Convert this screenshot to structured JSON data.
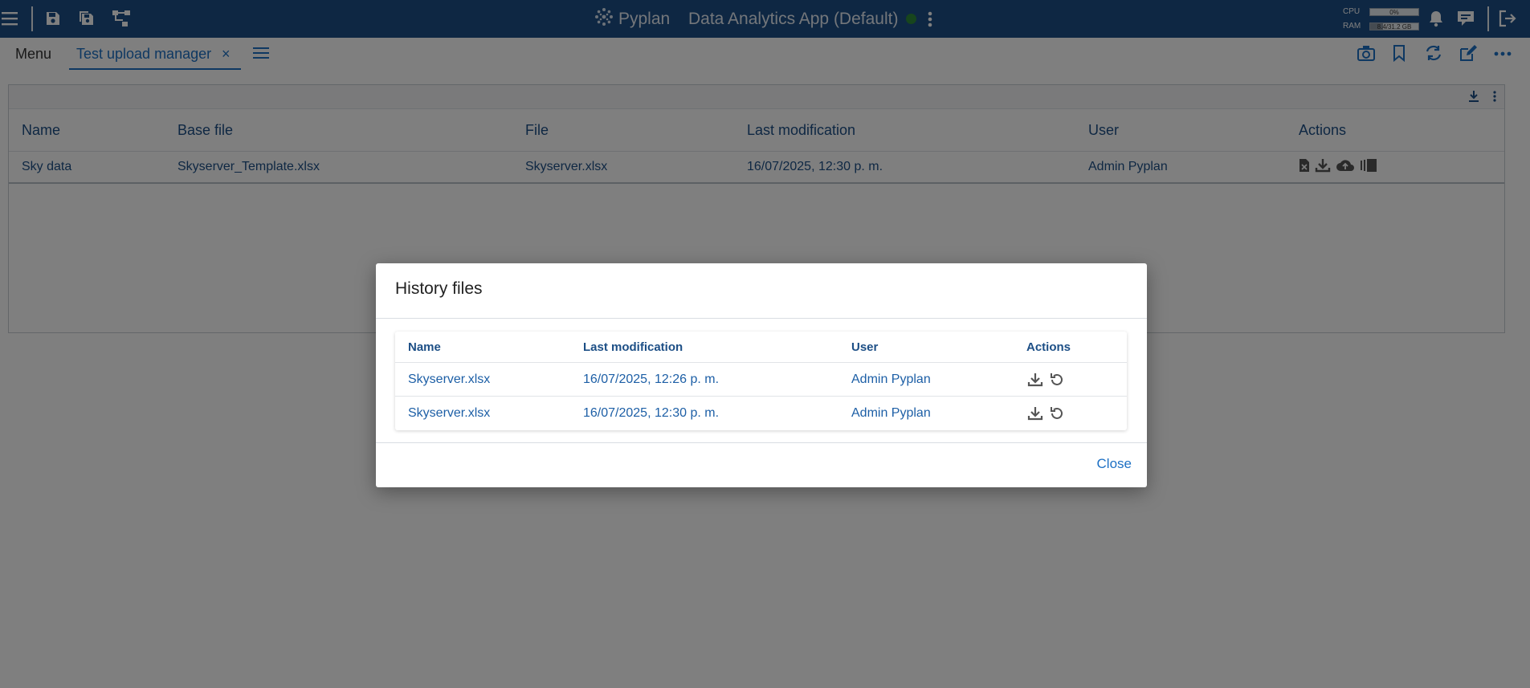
{
  "topbar": {
    "brand": "Pyplan",
    "app_title": "Data Analytics App (Default)",
    "cpu_label": "CPU",
    "cpu_value": "0%",
    "ram_label": "RAM",
    "ram_value": "8.4/31.2 GB",
    "cpu_fraction": 0,
    "ram_fraction": 0.27
  },
  "tabs": {
    "menu_label": "Menu",
    "active_tab": "Test upload manager",
    "close_glyph": "×"
  },
  "grid": {
    "headers": [
      "Name",
      "Base file",
      "File",
      "Last modification",
      "User",
      "Actions"
    ],
    "rows": [
      {
        "name": "Sky data",
        "base_file": "Skyserver_Template.xlsx",
        "file": "Skyserver.xlsx",
        "last_modification": "16/07/2025, 12:30 p. m.",
        "user": "Admin Pyplan"
      }
    ]
  },
  "modal": {
    "title": "History files",
    "headers": [
      "Name",
      "Last modification",
      "User",
      "Actions"
    ],
    "rows": [
      {
        "name": "Skyserver.xlsx",
        "last_modification": "16/07/2025, 12:26 p. m.",
        "user": "Admin Pyplan"
      },
      {
        "name": "Skyserver.xlsx",
        "last_modification": "16/07/2025, 12:30 p. m.",
        "user": "Admin Pyplan"
      }
    ],
    "close_label": "Close"
  },
  "colors": {
    "topbar": "#1d4f86",
    "accent": "#1d70c4",
    "status_ok": "#2e8a3a"
  },
  "icons": [
    "hamburger-icon",
    "save-icon",
    "save-all-icon",
    "diagram-icon",
    "pyplan-logo-icon",
    "more-vertical-icon",
    "bell-icon",
    "chat-icon",
    "logout-icon",
    "camera-icon",
    "bookmark-icon",
    "refresh-icon",
    "edit-icon",
    "more-horizontal-icon",
    "download-icon",
    "excel-file-icon",
    "cloud-upload-icon",
    "history-icon",
    "restore-icon"
  ]
}
